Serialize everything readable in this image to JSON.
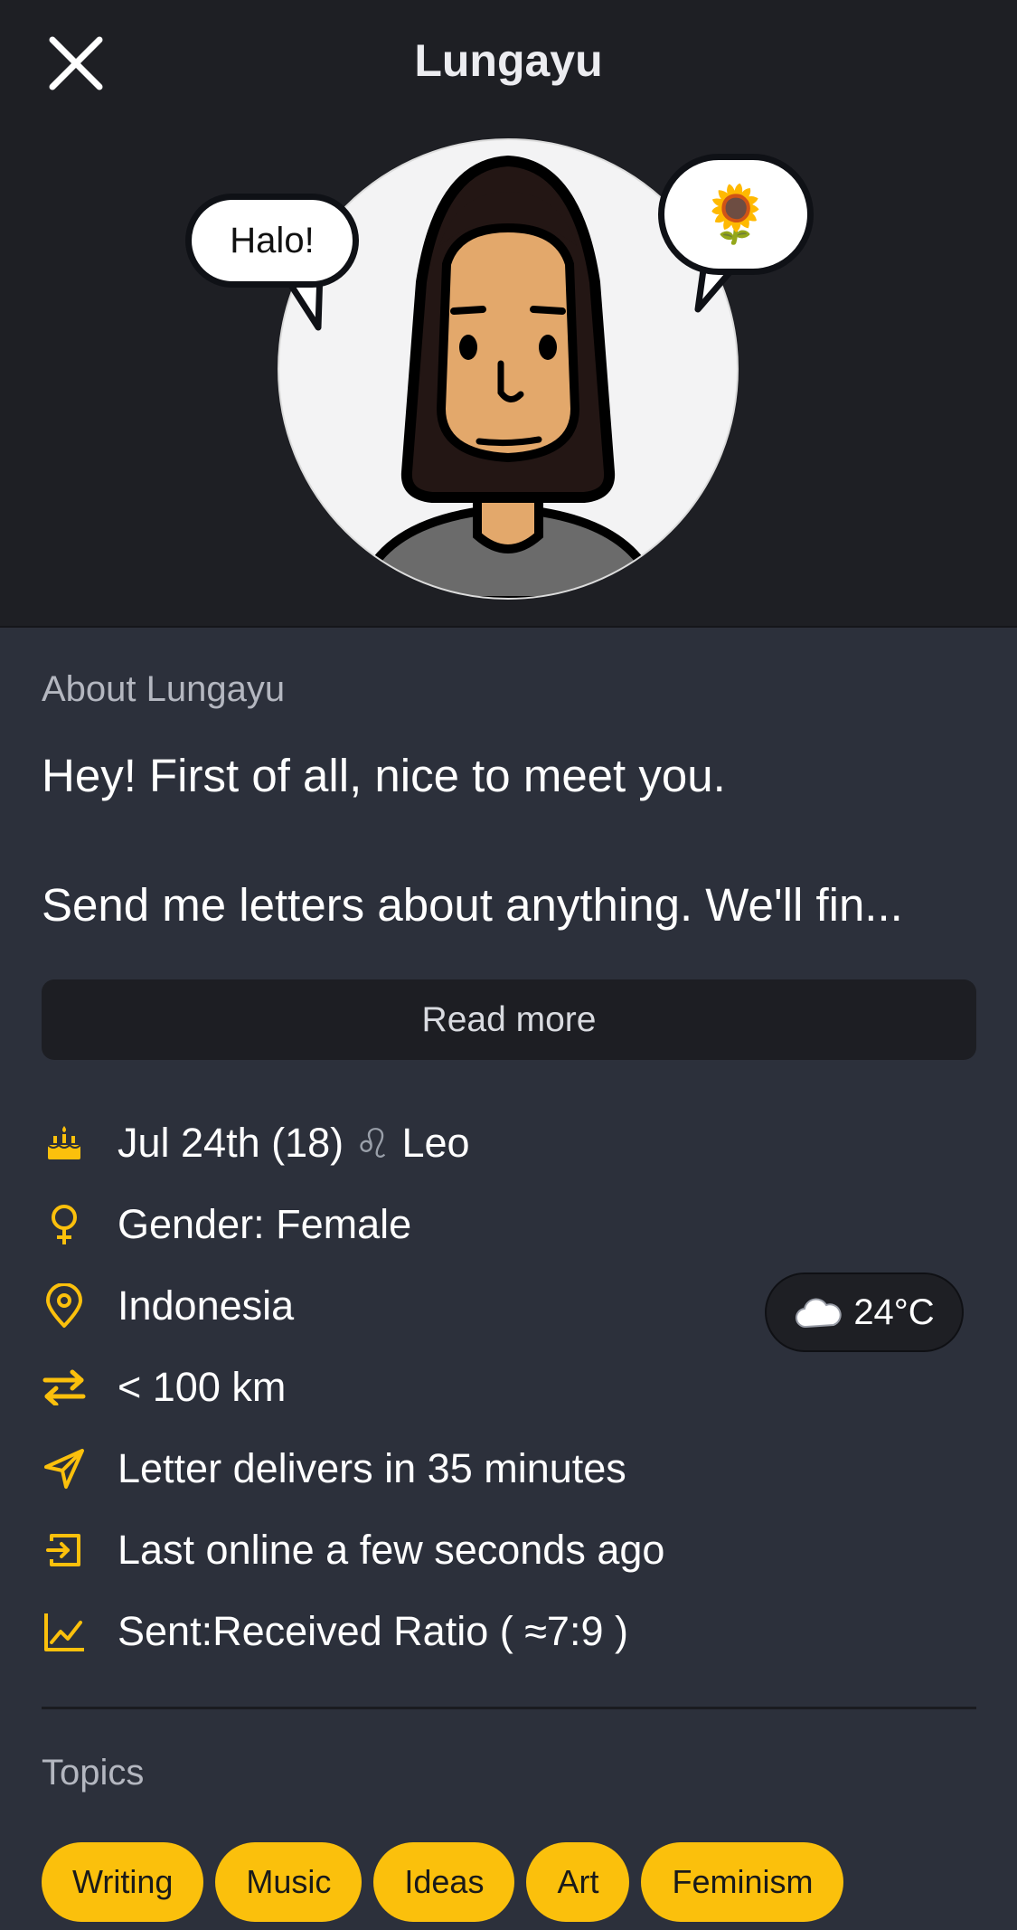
{
  "header": {
    "title": "Lungayu",
    "close_icon": "close-icon",
    "bubble_left_text": "Halo!",
    "bubble_right_emoji": "🌻"
  },
  "about": {
    "label": "About Lungayu",
    "line1": "Hey! First of all, nice to meet you.",
    "line2": "Send me letters about anything. We'll fin...",
    "read_more": "Read more"
  },
  "info": {
    "birthday": "Jul 24th (18)",
    "zodiac_symbol": "♌",
    "zodiac": "Leo",
    "gender": "Gender: Female",
    "location": "Indonesia",
    "distance": "< 100 km",
    "delivery": "Letter delivers in 35 minutes",
    "last_online": "Last online a few seconds ago",
    "ratio": "Sent:Received Ratio ( ≈7:9 )"
  },
  "weather": {
    "icon": "cloud-icon",
    "temperature": "24°C"
  },
  "topics": {
    "label": "Topics",
    "items": [
      "Writing",
      "Music",
      "Ideas",
      "Art",
      "Feminism"
    ]
  },
  "colors": {
    "accent": "#fbc00c",
    "header_bg": "#1e1f24",
    "body_bg": "#2c303b"
  }
}
